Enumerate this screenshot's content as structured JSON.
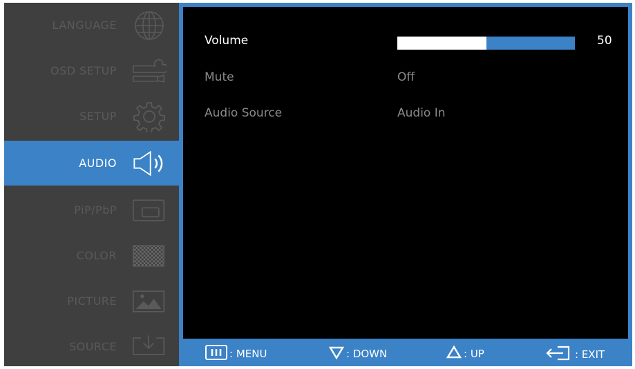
{
  "sidebar": {
    "items": [
      {
        "label": "LANGUAGE",
        "icon": "globe-icon"
      },
      {
        "label": "OSD SETUP",
        "icon": "tools-icon"
      },
      {
        "label": "SETUP",
        "icon": "gear-icon"
      },
      {
        "label": "AUDIO",
        "icon": "speaker-icon",
        "active": true
      },
      {
        "label": "PiP/PbP",
        "icon": "pip-icon"
      },
      {
        "label": "COLOR",
        "icon": "color-pattern-icon"
      },
      {
        "label": "PICTURE",
        "icon": "picture-icon"
      },
      {
        "label": "SOURCE",
        "icon": "input-source-icon"
      }
    ]
  },
  "audio": {
    "volume": {
      "label": "Volume",
      "value": "50",
      "level": 0.5
    },
    "mute": {
      "label": "Mute",
      "value": "Off"
    },
    "source": {
      "label": "Audio Source",
      "value": "Audio In"
    }
  },
  "footer": {
    "menu": ": MENU",
    "down": ": DOWN",
    "up": ": UP",
    "exit": ": EXIT"
  },
  "colors": {
    "accent": "#3b82c7",
    "panel_bg": "#000000",
    "sidebar_bg": "#3f3f3f"
  }
}
